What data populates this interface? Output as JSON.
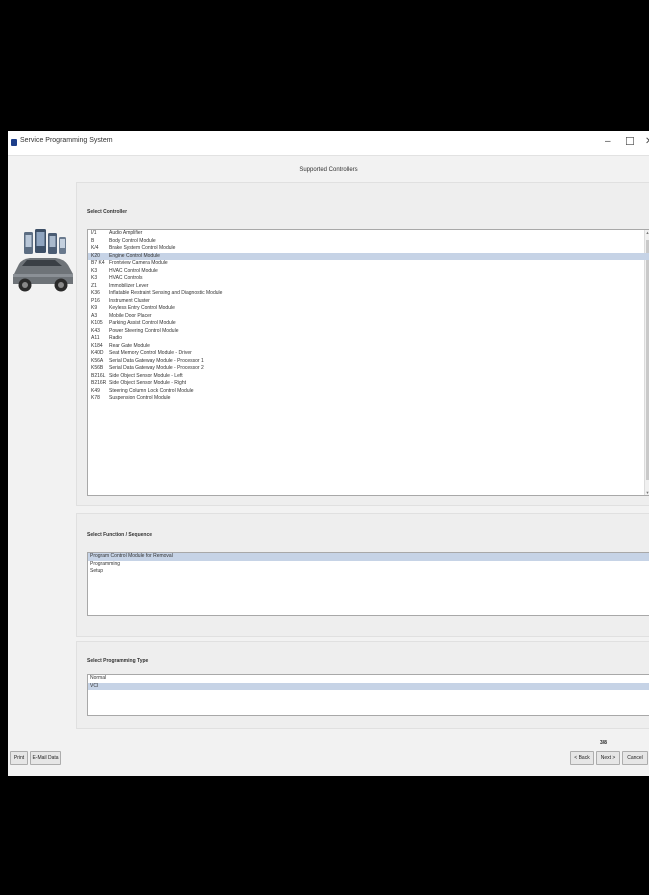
{
  "window": {
    "title": "Service Programming System",
    "minimize_glyph": "–",
    "maximize_glyph": "☐",
    "close_glyph": "✕"
  },
  "page_title": "Supported Controllers",
  "controllers": {
    "label": "Select Controller",
    "selected_index": 3,
    "items": [
      {
        "code": "I/1",
        "name": "Audio Amplifier"
      },
      {
        "code": "B",
        "name": "Body Control Module"
      },
      {
        "code": "K/4",
        "name": "Brake System Control Module"
      },
      {
        "code": "K20",
        "name": "Engine Control Module"
      },
      {
        "code": "B7 K4",
        "name": "Frontview Camera Module"
      },
      {
        "code": "K3",
        "name": "HVAC Control Module"
      },
      {
        "code": "K3",
        "name": "HVAC Controls"
      },
      {
        "code": "Z1",
        "name": "Immobilizer Lever"
      },
      {
        "code": "K36",
        "name": "Inflatable Restraint Sensing and Diagnostic Module"
      },
      {
        "code": "P16",
        "name": "Instrument Cluster"
      },
      {
        "code": "K9",
        "name": "Keyless Entry Control Module"
      },
      {
        "code": "A3",
        "name": "Mobile Door Placer"
      },
      {
        "code": "K105",
        "name": "Parking Assist Control Module"
      },
      {
        "code": "K43",
        "name": "Power Steering Control Module"
      },
      {
        "code": "A11",
        "name": "Radio"
      },
      {
        "code": "K184",
        "name": "Rear Gate Module"
      },
      {
        "code": "K40D",
        "name": "Seat Memory Control Module - Driver"
      },
      {
        "code": "K56A",
        "name": "Serial Data Gateway Module - Processor 1"
      },
      {
        "code": "K56B",
        "name": "Serial Data Gateway Module - Processor 2"
      },
      {
        "code": "B216L",
        "name": "Side Object Sensor Module - Left"
      },
      {
        "code": "B216R",
        "name": "Side Object Sensor Module - Right"
      },
      {
        "code": "K49",
        "name": "Steering Column Lock Control Module"
      },
      {
        "code": "K78",
        "name": "Suspension Control Module"
      }
    ]
  },
  "functions": {
    "label": "Select Function / Sequence",
    "selected_index": 0,
    "items": [
      "Program Control Module for Removal",
      "Programming",
      "Setup"
    ]
  },
  "programming_type": {
    "label": "Select Programming Type",
    "selected_index": 1,
    "items": [
      "Normal",
      "VCI"
    ]
  },
  "footer": {
    "left_buttons": [
      "Print",
      "E-Mail Data"
    ],
    "right_buttons": [
      "< Back",
      "Next >",
      "Cancel"
    ],
    "page_counter": "3/8"
  },
  "colors": {
    "selection": "#c6d3e6",
    "window_bg": "#f2f2f2",
    "app_icon": "#1d3e8a"
  }
}
